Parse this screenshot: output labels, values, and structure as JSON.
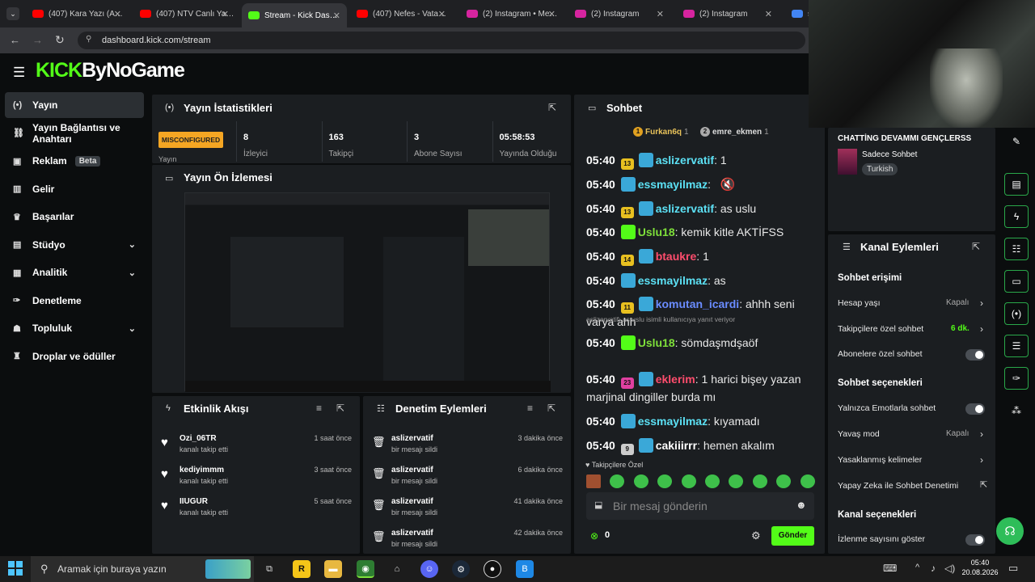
{
  "browser": {
    "tabs": [
      {
        "label": "(407) Kara Yazı (A…",
        "icon": "youtube-icon",
        "color": "#ff0000"
      },
      {
        "label": "(407) NTV Canlı Ya…",
        "icon": "youtube-icon",
        "color": "#ff0000"
      },
      {
        "label": "Stream - Kick Das…",
        "icon": "kick-icon",
        "color": "#53fc18",
        "active": true
      },
      {
        "label": "(407) Nefes - Vata…",
        "icon": "youtube-icon",
        "color": "#ff0000"
      },
      {
        "label": "(2) Instagram • Me…",
        "icon": "instagram-icon",
        "color": "#d6249f"
      },
      {
        "label": "(2) Instagram",
        "icon": "instagram-icon",
        "color": "#d6249f"
      },
      {
        "label": "(2) Instagram",
        "icon": "instagram-icon",
        "color": "#d6249f"
      },
      {
        "label": "s",
        "icon": "google-icon",
        "color": "#4285f4"
      }
    ],
    "url": "dashboard.kick.com/stream"
  },
  "logo": {
    "brand": "KICK",
    "text": "ByNoGame",
    "accent": "#53fc18"
  },
  "sidebar": {
    "items": [
      {
        "label": "Yayın",
        "icon": "broadcast-icon",
        "active": true
      },
      {
        "label": "Yayın Bağlantısı ve Anahtarı",
        "icon": "link-icon"
      },
      {
        "label": "Reklam",
        "icon": "ad-icon",
        "badge": "Beta"
      },
      {
        "label": "Gelir",
        "icon": "revenue-icon"
      },
      {
        "label": "Başarılar",
        "icon": "trophy-icon"
      },
      {
        "label": "Stüdyo",
        "icon": "studio-icon",
        "chevron": true
      },
      {
        "label": "Analitik",
        "icon": "analytics-icon",
        "chevron": true
      },
      {
        "label": "Denetleme",
        "icon": "wrench-icon"
      },
      {
        "label": "Topluluk",
        "icon": "community-icon",
        "chevron": true
      },
      {
        "label": "Droplar ve ödüller",
        "icon": "gift-icon"
      }
    ]
  },
  "stats": {
    "title": "Yayın İstatistikleri",
    "status": "MISCONFIGURED",
    "status_sub": "Yayın",
    "items": [
      {
        "value": "8",
        "label": "İzleyici"
      },
      {
        "value": "163",
        "label": "Takipçi"
      },
      {
        "value": "3",
        "label": "Abone Sayısı"
      },
      {
        "value": "05:58:53",
        "label": "Yayında Olduğu"
      }
    ]
  },
  "preview": {
    "title": "Yayın Ön İzlemesi"
  },
  "activity": {
    "title": "Etkinlik Akışı",
    "items": [
      {
        "user": "Ozi_06TR",
        "action": "kanalı takip etti",
        "time": "1 saat önce"
      },
      {
        "user": "kediyimmm",
        "action": "kanalı takip etti",
        "time": "3 saat önce"
      },
      {
        "user": "IIUGUR",
        "action": "kanalı takip etti",
        "time": "5 saat önce"
      }
    ]
  },
  "moderation": {
    "title": "Denetim Eylemleri",
    "items": [
      {
        "user": "aslizervatif",
        "action": "bir mesajı sildi",
        "time": "3 dakika önce"
      },
      {
        "user": "aslizervatif",
        "action": "bir mesajı sildi",
        "time": "6 dakika önce"
      },
      {
        "user": "aslizervatif",
        "action": "bir mesajı sildi",
        "time": "41 dakika önce"
      },
      {
        "user": "aslizervatif",
        "action": "bir mesajı sildi",
        "time": "42 dakika önce"
      }
    ]
  },
  "chat": {
    "title": "Sohbet",
    "top_gifters": [
      {
        "rank": "1",
        "name": "Furkan6q",
        "count": "1"
      },
      {
        "rank": "2",
        "name": "emre_ekmen",
        "count": "1"
      }
    ],
    "messages": [
      {
        "time": "05:40",
        "badge": "13",
        "user": "aslizervatif",
        "color": "#5ce1f5",
        "text": "1"
      },
      {
        "time": "05:40",
        "badge": "",
        "user": "essmayilmaz",
        "color": "#5ce1f5",
        "text": ""
      },
      {
        "time": "05:40",
        "badge": "13",
        "user": "aslizervatif",
        "color": "#5ce1f5",
        "text": "as uslu"
      },
      {
        "time": "05:40",
        "badge": "",
        "user": "Uslu18",
        "color": "#7ee03a",
        "text": "kemik kitle AKTİFSS"
      },
      {
        "time": "05:40",
        "badge": "14",
        "user": "btaukre",
        "color": "#ff4d6d",
        "text": "1"
      },
      {
        "time": "05:40",
        "badge": "",
        "user": "essmayilmaz",
        "color": "#5ce1f5",
        "text": "as"
      },
      {
        "time": "05:40",
        "badge": "11",
        "user": "komutan_icardi",
        "color": "#6a8cff",
        "text": "ahhh seni varya ahh"
      },
      {
        "reply": "aslizervatif: as uslu isimli kullanıcıya yanıt veriyor",
        "time": "05:40",
        "badge": "",
        "user": "Uslu18",
        "color": "#7ee03a",
        "text": "sömdaşmdşaöf"
      },
      {
        "time": "05:40",
        "badge": "23",
        "user": "eklerim",
        "color": "#ff4d6d",
        "text": "1 harici bişey yazan marjinal dingiller burda mı"
      },
      {
        "time": "05:40",
        "badge": "",
        "user": "essmayilmaz",
        "color": "#5ce1f5",
        "text": "kıyamadı"
      },
      {
        "time": "05:40",
        "badge": "9",
        "user": "cakiiirrr",
        "color": "#ffffff",
        "text": "hemen akalım"
      }
    ],
    "followers_label": "Takipçilere Özel",
    "placeholder": "Bir mesaj gönderin",
    "count": "0",
    "send_label": "Gönder"
  },
  "stream_info": {
    "title": "CHATTİNG DEVAMMI GENÇLERSS",
    "mode": "Sadece Sohbet",
    "tag": "Turkish"
  },
  "channel_actions": {
    "title": "Kanal Eylemleri",
    "section1": "Sohbet erişimi",
    "account_age": "Hesap yaşı",
    "account_age_val": "Kapalı",
    "followers_only": "Takipçilere özel sohbet",
    "followers_only_val": "6 dk.",
    "subs_only": "Abonelere özel sohbet",
    "section2": "Sohbet seçenekleri",
    "emote_only": "Yalnızca Emotlarla sohbet",
    "slow_mode": "Yavaş mod",
    "slow_mode_val": "Kapalı",
    "banned_words": "Yasaklanmış kelimeler",
    "ai_mod": "Yapay Zeka ile Sohbet Denetimi",
    "section3": "Kanal seçenekleri",
    "show_viewers": "İzlenme sayısını göster"
  },
  "taskbar": {
    "search": "Aramak için buraya yazın",
    "time": "05:40",
    "date": "20.08.2026"
  }
}
